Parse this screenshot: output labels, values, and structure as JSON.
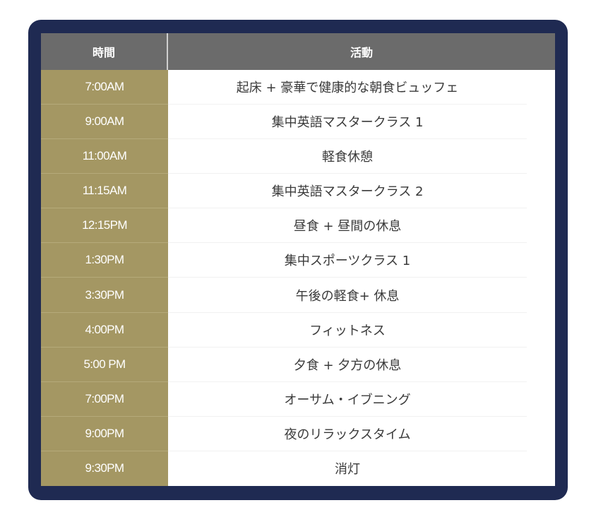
{
  "header": {
    "time_label": "時間",
    "activity_label": "活動"
  },
  "rows": [
    {
      "time": "7:00AM",
      "activity": "起床 + 豪華で健康的な朝食ビュッフェ"
    },
    {
      "time": "9:00AM",
      "activity": "集中英語マスタークラス 1"
    },
    {
      "time": "11:00AM",
      "activity": "軽食休憩"
    },
    {
      "time": "11:15AM",
      "activity": "集中英語マスタークラス 2"
    },
    {
      "time": "12:15PM",
      "activity": "昼食 + 昼間の休息"
    },
    {
      "time": "1:30PM",
      "activity": "集中スポーツクラス 1"
    },
    {
      "time": "3:30PM",
      "activity": "午後の軽食+ 休息"
    },
    {
      "time": "4:00PM",
      "activity": "フィットネス"
    },
    {
      "time": "5:00 PM",
      "activity": "夕食 + 夕方の休息"
    },
    {
      "time": "7:00PM",
      "activity": "オーサム・イブニング"
    },
    {
      "time": "9:00PM",
      "activity": "夜のリラックスタイム"
    },
    {
      "time": "9:30PM",
      "activity": "消灯"
    }
  ],
  "colors": {
    "frame": "#1f2a52",
    "header": "#6b6b6b",
    "time_column": "#a49763"
  }
}
